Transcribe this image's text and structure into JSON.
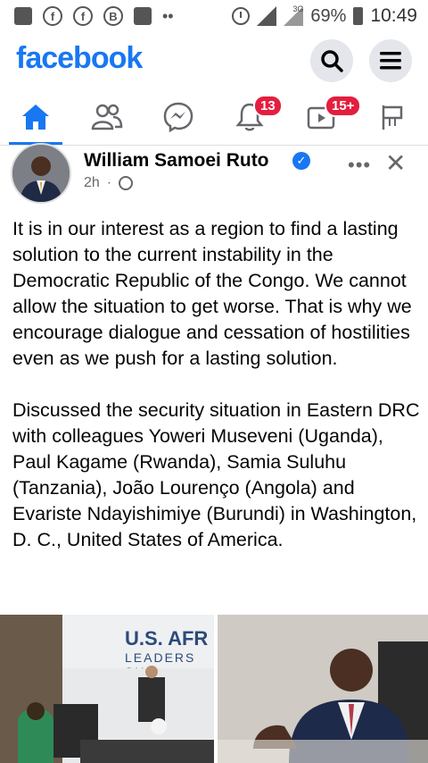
{
  "status_bar": {
    "battery": "69%",
    "time": "10:49",
    "network": "3G"
  },
  "header": {
    "logo": "facebook",
    "brand_color": "#1877f2"
  },
  "tabs": [
    {
      "name": "home",
      "icon": "home-icon",
      "badge": ""
    },
    {
      "name": "friends",
      "icon": "friends-icon",
      "badge": ""
    },
    {
      "name": "messenger",
      "icon": "messenger-icon",
      "badge": ""
    },
    {
      "name": "notifications",
      "icon": "bell-icon",
      "badge": "13"
    },
    {
      "name": "watch",
      "icon": "video-icon",
      "badge": "15+"
    },
    {
      "name": "pages",
      "icon": "flag-icon",
      "badge": ""
    }
  ],
  "post": {
    "author": "William Samoei Ruto",
    "time": "2h",
    "text": "It is in our interest as a region to find a lasting solution to the current instability in the Democratic Republic of the Congo. We cannot allow the situation to get worse. That is why we encourage dialogue and cessation of hostilities even as we push for a lasting solution.\n\nDiscussed the security situation in Eastern DRC with colleagues Yoweri Museveni (Uganda), Paul Kagame (Rwanda), Samia Suluhu (Tanzania), João Lourenço (Angola) and Evariste Ndayishimiye (Burundi) in Washington, D. C., United States of America.",
    "photo1_banner": "U.S. AFR",
    "photo1_sub": "LEADERS SU"
  }
}
